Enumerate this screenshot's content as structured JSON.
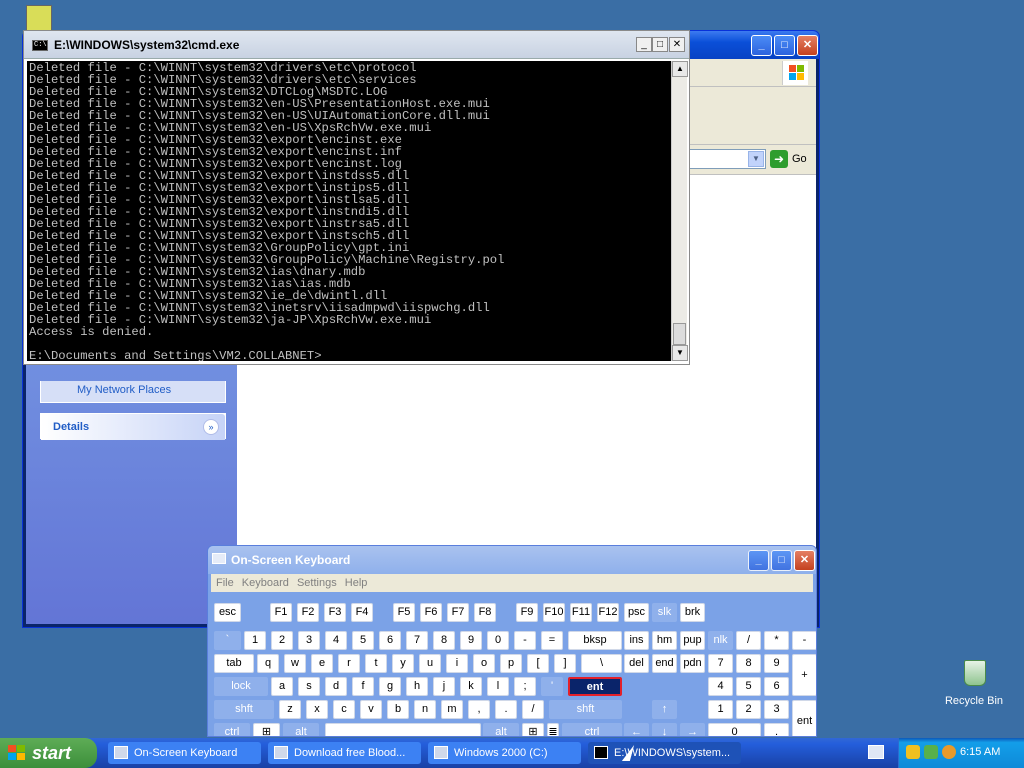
{
  "explorer": {
    "address_go": "Go",
    "network_places": "My Network Places",
    "details_label": "Details"
  },
  "cmd": {
    "title": "E:\\WINDOWS\\system32\\cmd.exe",
    "lines": [
      "Deleted file - C:\\WINNT\\system32\\drivers\\etc\\protocol",
      "Deleted file - C:\\WINNT\\system32\\drivers\\etc\\services",
      "Deleted file - C:\\WINNT\\system32\\DTCLog\\MSDTC.LOG",
      "Deleted file - C:\\WINNT\\system32\\en-US\\PresentationHost.exe.mui",
      "Deleted file - C:\\WINNT\\system32\\en-US\\UIAutomationCore.dll.mui",
      "Deleted file - C:\\WINNT\\system32\\en-US\\XpsRchVw.exe.mui",
      "Deleted file - C:\\WINNT\\system32\\export\\encinst.exe",
      "Deleted file - C:\\WINNT\\system32\\export\\encinst.inf",
      "Deleted file - C:\\WINNT\\system32\\export\\encinst.log",
      "Deleted file - C:\\WINNT\\system32\\export\\instdss5.dll",
      "Deleted file - C:\\WINNT\\system32\\export\\instips5.dll",
      "Deleted file - C:\\WINNT\\system32\\export\\instlsa5.dll",
      "Deleted file - C:\\WINNT\\system32\\export\\instndi5.dll",
      "Deleted file - C:\\WINNT\\system32\\export\\instrsa5.dll",
      "Deleted file - C:\\WINNT\\system32\\export\\instsch5.dll",
      "Deleted file - C:\\WINNT\\system32\\GroupPolicy\\gpt.ini",
      "Deleted file - C:\\WINNT\\system32\\GroupPolicy\\Machine\\Registry.pol",
      "Deleted file - C:\\WINNT\\system32\\ias\\dnary.mdb",
      "Deleted file - C:\\WINNT\\system32\\ias\\ias.mdb",
      "Deleted file - C:\\WINNT\\system32\\ie_de\\dwintl.dll",
      "Deleted file - C:\\WINNT\\system32\\inetsrv\\iisadmpwd\\iispwchg.dll",
      "Deleted file - C:\\WINNT\\system32\\ja-JP\\XpsRchVw.exe.mui",
      "Access is denied.",
      "",
      "E:\\Documents and Settings\\VM2.COLLABNET>"
    ]
  },
  "osk": {
    "title": "On-Screen Keyboard",
    "menu": [
      "File",
      "Keyboard",
      "Settings",
      "Help"
    ],
    "keys": {
      "esc": "esc",
      "f1": "F1",
      "f2": "F2",
      "f3": "F3",
      "f4": "F4",
      "f5": "F5",
      "f6": "F6",
      "f7": "F7",
      "f8": "F8",
      "f9": "F9",
      "f10": "F10",
      "f11": "F11",
      "f12": "F12",
      "psc": "psc",
      "slk": "slk",
      "brk": "brk",
      "grave": "`",
      "n1": "1",
      "n2": "2",
      "n3": "3",
      "n4": "4",
      "n5": "5",
      "n6": "6",
      "n7": "7",
      "n8": "8",
      "n9": "9",
      "n0": "0",
      "minus": "-",
      "equals": "=",
      "bksp": "bksp",
      "ins": "ins",
      "hm": "hm",
      "pup": "pup",
      "nlk": "nlk",
      "ndiv": "/",
      "nmul": "*",
      "nsub": "-",
      "tab": "tab",
      "q": "q",
      "w": "w",
      "e": "e",
      "r": "r",
      "t": "t",
      "y": "y",
      "u": "u",
      "i": "i",
      "o": "o",
      "p": "p",
      "lbr": "[",
      "rbr": "]",
      "bslash": "\\",
      "del": "del",
      "end": "end",
      "pdn": "pdn",
      "np7": "7",
      "np8": "8",
      "np9": "9",
      "nadd": "+",
      "lock": "lock",
      "a": "a",
      "s": "s",
      "d": "d",
      "f": "f",
      "g": "g",
      "h": "h",
      "j": "j",
      "k": "k",
      "l": "l",
      "semi": ";",
      "quote": "'",
      "ent": "ent",
      "np4": "4",
      "np5": "5",
      "np6": "6",
      "lshft": "shft",
      "z": "z",
      "x": "x",
      "c": "c",
      "v": "v",
      "b": "b",
      "n": "n",
      "m": "m",
      "comma": ",",
      "period": ".",
      "slash": "/",
      "rshft": "shft",
      "np1": "1",
      "np2": "2",
      "np3": "3",
      "nent": "ent",
      "lctrl": "ctrl",
      "lalt": "alt",
      "ralt": "alt",
      "rctrl": "ctrl",
      "np0": "0",
      "npdot": "."
    }
  },
  "taskbar": {
    "start": "start",
    "tasks": [
      "On-Screen Keyboard",
      "Download free Blood...",
      "Windows 2000 (C:)",
      "E:\\WINDOWS\\system..."
    ],
    "clock": "6:15 AM"
  },
  "desktop": {
    "recycle_bin": "Recycle Bin"
  }
}
